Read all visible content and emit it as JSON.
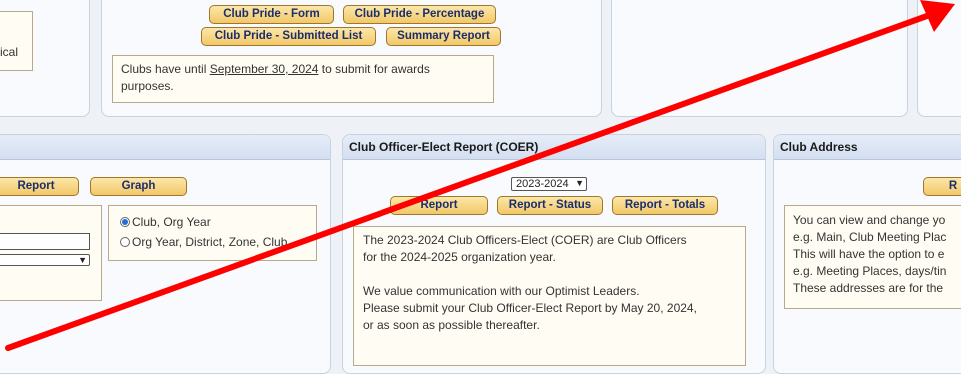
{
  "colors": {
    "arrow": "#ff0000",
    "button_fill": "#f2c868",
    "panel_header": "#d3def0"
  },
  "top_left": {
    "text": "ical"
  },
  "club_pride": {
    "buttons": [
      "Club Pride - Form",
      "Club Pride - Percentage",
      "Club Pride - Submitted List",
      "Summary Report"
    ],
    "note_prefix": "Clubs have until ",
    "note_date": "September 30, 2024",
    "note_suffix": " to submit for awards",
    "note_line2": "purposes."
  },
  "left_panel": {
    "buttons": [
      "Report",
      "Graph"
    ],
    "radio1": "Club, Org Year",
    "radio2": "Org Year, District, Zone, Club"
  },
  "coer": {
    "title": "Club Officer-Elect Report (COER)",
    "year_select": "2023-2024",
    "buttons": [
      "Report",
      "Report - Status",
      "Report - Totals"
    ],
    "lines": [
      "The 2023-2024 Club Officers-Elect (COER) are Club Officers",
      "for the 2024-2025 organization year.",
      "",
      "We value communication with our Optimist Leaders.",
      "Please submit your Club Officer-Elect Report by May 20, 2024,",
      "or as soon as possible thereafter."
    ]
  },
  "club_address": {
    "title": "Club Address",
    "button": "R",
    "lines": [
      "You can view and change yo",
      "e.g. Main, Club Meeting Plac",
      "This will have the option to e",
      "e.g. Meeting Places, days/tin",
      "These addresses are for the"
    ]
  }
}
